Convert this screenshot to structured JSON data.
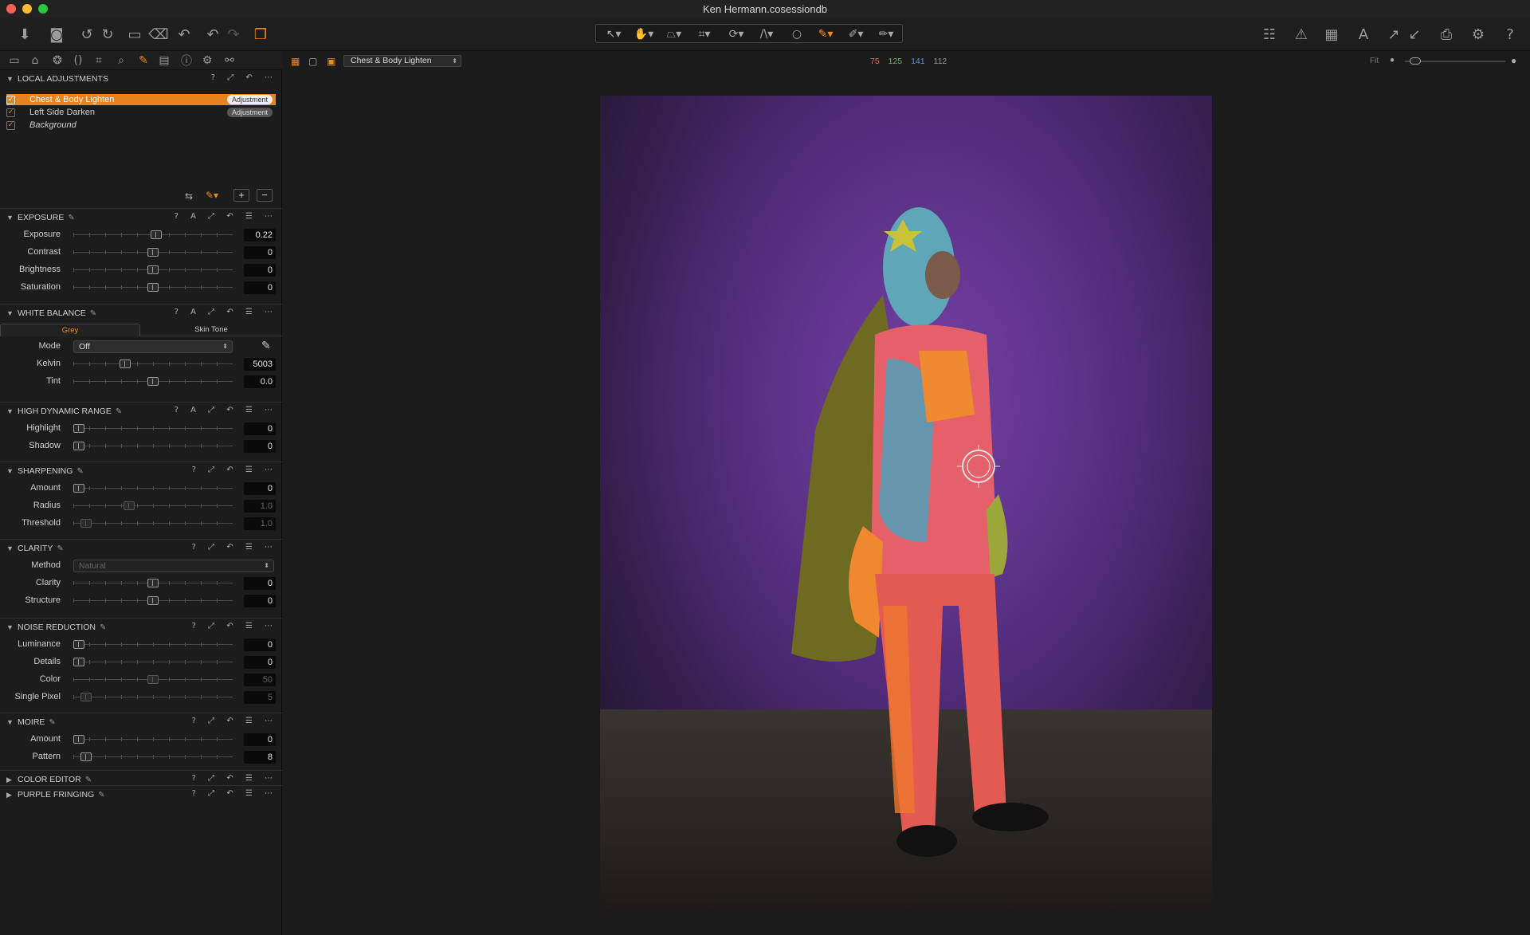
{
  "window": {
    "title": "Ken Hermann.cosessiondb"
  },
  "colors": {
    "accent": "#f08a1e",
    "selected_row": "#e8821c",
    "rgb_r": "#e36b60",
    "rgb_g": "#5fbf5f",
    "rgb_b": "#5f8fe6"
  },
  "toolbar": {
    "left_icons": [
      "import-icon",
      "camera-icon",
      "rotate-left-icon",
      "rotate-right-icon",
      "move-to-icon",
      "trash-icon",
      "reset-icon",
      "undo-icon",
      "redo-icon",
      "variants-icon"
    ],
    "cursor_tools": [
      "select-cursor-icon",
      "pan-icon",
      "keystone-icon",
      "crop-icon",
      "rotate-icon",
      "straighten-icon",
      "circle-icon",
      "brush-icon",
      "gradient-icon",
      "eraser-icon"
    ],
    "right_icons": [
      "viewer-layout-icon",
      "warning-icon",
      "grid-icon",
      "text-overlay-icon",
      "copy-adjustments-icon",
      "apply-adjustments-icon",
      "print-icon",
      "settings-icon",
      "help-icon"
    ]
  },
  "viewer_bar": {
    "layer_select": "Chest & Body Lighten",
    "rgb": {
      "r": "75",
      "g": "125",
      "b": "141",
      "l": "112"
    },
    "fit_label": "Fit"
  },
  "local_adjustments": {
    "title": "LOCAL ADJUSTMENTS",
    "layers": [
      {
        "name": "Chest & Body Lighten",
        "badge": "Adjustment",
        "checked": true,
        "selected": true
      },
      {
        "name": "Left Side Darken",
        "badge": "Adjustment",
        "checked": true,
        "selected": false
      },
      {
        "name": "Background",
        "badge": "",
        "checked": true,
        "selected": false
      }
    ]
  },
  "exposure": {
    "title": "EXPOSURE",
    "rows": [
      {
        "label": "Exposure",
        "value": "0.22",
        "pos": 0.52
      },
      {
        "label": "Contrast",
        "value": "0",
        "pos": 0.5
      },
      {
        "label": "Brightness",
        "value": "0",
        "pos": 0.5
      },
      {
        "label": "Saturation",
        "value": "0",
        "pos": 0.5
      }
    ]
  },
  "white_balance": {
    "title": "WHITE BALANCE",
    "tabs": [
      "Grey",
      "Skin Tone"
    ],
    "mode_label": "Mode",
    "mode_value": "Off",
    "rows": [
      {
        "label": "Kelvin",
        "value": "5003",
        "pos": 0.31
      },
      {
        "label": "Tint",
        "value": "0.0",
        "pos": 0.5
      }
    ]
  },
  "hdr": {
    "title": "HIGH DYNAMIC RANGE",
    "rows": [
      {
        "label": "Highlight",
        "value": "0",
        "pos": 0.0
      },
      {
        "label": "Shadow",
        "value": "0",
        "pos": 0.0
      }
    ]
  },
  "sharpening": {
    "title": "SHARPENING",
    "rows": [
      {
        "label": "Amount",
        "value": "0",
        "pos": 0.0,
        "disabled": false
      },
      {
        "label": "Radius",
        "value": "1.0",
        "pos": 0.34,
        "disabled": true
      },
      {
        "label": "Threshold",
        "value": "1.0",
        "pos": 0.05,
        "disabled": true
      }
    ]
  },
  "clarity": {
    "title": "CLARITY",
    "method_label": "Method",
    "method_value": "Natural",
    "rows": [
      {
        "label": "Clarity",
        "value": "0",
        "pos": 0.5
      },
      {
        "label": "Structure",
        "value": "0",
        "pos": 0.5
      }
    ]
  },
  "noise_reduction": {
    "title": "NOISE REDUCTION",
    "rows": [
      {
        "label": "Luminance",
        "value": "0",
        "pos": 0.0,
        "disabled": false
      },
      {
        "label": "Details",
        "value": "0",
        "pos": 0.0,
        "disabled": false
      },
      {
        "label": "Color",
        "value": "50",
        "pos": 0.5,
        "disabled": true
      },
      {
        "label": "Single Pixel",
        "value": "5",
        "pos": 0.05,
        "disabled": true
      }
    ]
  },
  "moire": {
    "title": "MOIRE",
    "rows": [
      {
        "label": "Amount",
        "value": "0",
        "pos": 0.0
      },
      {
        "label": "Pattern",
        "value": "8",
        "pos": 0.05
      }
    ]
  },
  "collapsed": [
    "COLOR EDITOR",
    "PURPLE FRINGING"
  ]
}
